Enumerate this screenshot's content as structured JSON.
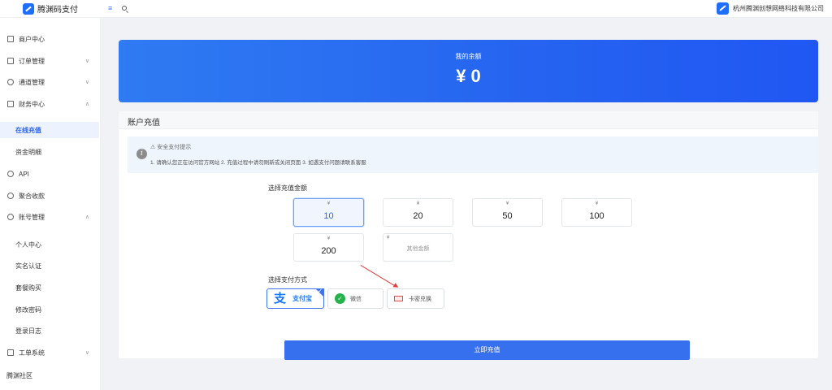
{
  "app": {
    "name": "腾渊码支付",
    "company": "杭州腾渊创想网络科技有限公司"
  },
  "sidebar": {
    "items": [
      {
        "label": "商户中心"
      },
      {
        "label": "订单管理"
      },
      {
        "label": "通道管理"
      },
      {
        "label": "财务中心"
      },
      {
        "label": "在线充值"
      },
      {
        "label": "资金明细"
      },
      {
        "label": "API"
      },
      {
        "label": "聚合收款"
      },
      {
        "label": "账号管理"
      },
      {
        "label": "个人中心"
      },
      {
        "label": "实名认证"
      },
      {
        "label": "套餐购买"
      },
      {
        "label": "修改密码"
      },
      {
        "label": "登录日志"
      },
      {
        "label": "工单系统"
      },
      {
        "label": "腾渊社区"
      }
    ]
  },
  "balance": {
    "label": "我的余额",
    "value": "¥ 0"
  },
  "recharge": {
    "title": "账户充值",
    "notice_title": "⚠ 安全支付提示",
    "notice_text": "1. 请确认您正在访问官方网站 2. 充值过程中请勿刷新或关闭页面 3. 如遇支付问题请联系客服",
    "amount_label": "选择充值金额",
    "currency": "¥",
    "amounts": [
      "10",
      "20",
      "50",
      "100",
      "200"
    ],
    "selected_amount": "10",
    "custom_label": "其他金额",
    "pay_label": "选择支付方式",
    "methods": [
      {
        "label": "支付宝",
        "icon": "alipay-icon"
      },
      {
        "label": "微信",
        "icon": "wechat-icon"
      },
      {
        "label": "卡密兑换",
        "icon": "card-icon"
      }
    ],
    "selected_method": "支付宝",
    "submit_label": "立即充值"
  },
  "colors": {
    "primary": "#3670ef",
    "banner_start": "#2f7bf2",
    "banner_end": "#2057f3",
    "alipay": "#1677ff",
    "wechat": "#24b24b",
    "annotation_arrow": "#e23b3b"
  }
}
